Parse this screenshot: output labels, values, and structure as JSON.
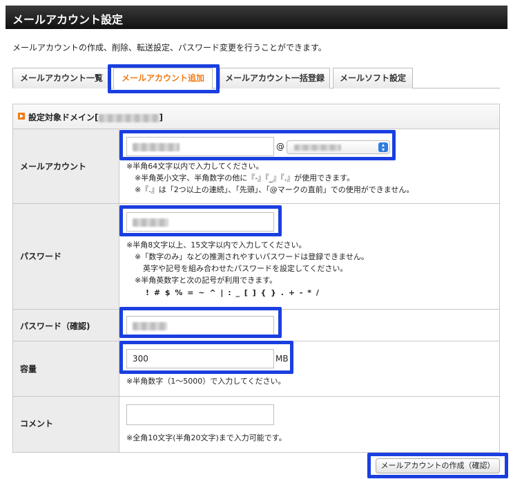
{
  "header": {
    "title": "メールアカウント設定"
  },
  "description": "メールアカウントの作成、削除、転送設定、パスワード変更を行うことができます。",
  "tabs": [
    {
      "label": "メールアカウント一覧",
      "active": false
    },
    {
      "label": "メールアカウント追加",
      "active": true
    },
    {
      "label": "メールアカウント一括登録",
      "active": false
    },
    {
      "label": "メールソフト設定",
      "active": false
    }
  ],
  "domain_section": {
    "label_prefix": "設定対象ドメイン[",
    "label_suffix": "]"
  },
  "account": {
    "label": "メールアカウント",
    "at_sign": "@",
    "notes": [
      "※半角64文字以内で入力してください。",
      "※半角英小文字、半角数字の他に『-』『_』『.』が使用できます。",
      "※『.』は「2つ以上の連続」、「先頭」、「@マークの直前」での使用ができません。"
    ]
  },
  "password": {
    "label": "パスワード",
    "notes": [
      "※半角8文字以上、15文字以内で入力してください。",
      "※「数字のみ」などの推測されやすいパスワードは登録できません。",
      "英字や記号を組み合わせたパスワードを設定してください。",
      "※半角英数字と次の記号が利用できます。",
      "! # $ % = ~ ^ | : _ [ ] { } . + - * /"
    ]
  },
  "password_confirm": {
    "label": "パスワード（確認)"
  },
  "capacity": {
    "label": "容量",
    "value": "300",
    "unit": "MB",
    "note": "※半角数字（1～5000）で入力してください。"
  },
  "comment": {
    "label": "コメント",
    "value": "",
    "note": "※全角10文字(半角20文字)まで入力可能です。"
  },
  "submit_label": "メールアカウントの作成（確認）",
  "colors": {
    "highlight": "#1a3fe0",
    "accent": "#f07a14",
    "titlebar": "#1a1a1a"
  }
}
